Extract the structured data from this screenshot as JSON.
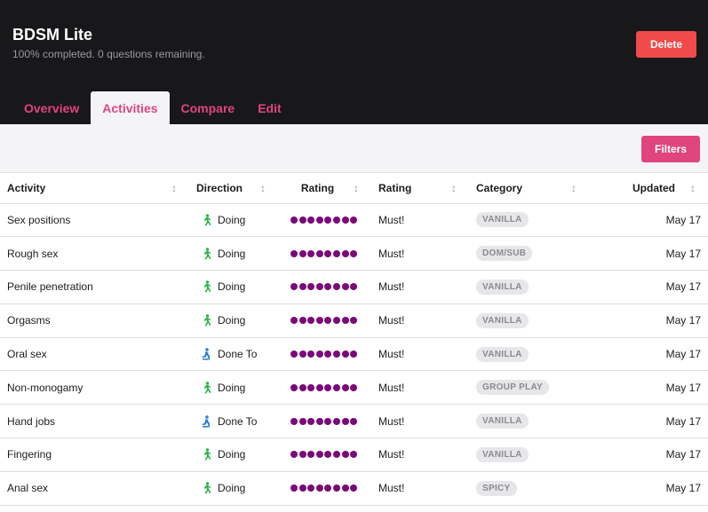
{
  "header": {
    "title": "BDSM Lite",
    "subtitle": "100% completed. 0 questions remaining.",
    "delete_label": "Delete",
    "bg_color": "#18181a",
    "delete_color": "#f04a4a"
  },
  "tabs": [
    {
      "label": "Overview",
      "active": false
    },
    {
      "label": "Activities",
      "active": true
    },
    {
      "label": "Compare",
      "active": false
    },
    {
      "label": "Edit",
      "active": false
    }
  ],
  "toolbar": {
    "filters_label": "Filters",
    "accent": "#e0457b"
  },
  "table": {
    "columns": [
      "Activity",
      "Direction",
      "Rating",
      "Rating",
      "Category",
      "Updated"
    ],
    "rating_color": "#7a0a78",
    "rows": [
      {
        "activity": "Sex positions",
        "direction": "Doing",
        "direction_icon": "running-person-icon",
        "dots": 8,
        "rating": "Must!",
        "category": "VANILLA",
        "updated": "May 17"
      },
      {
        "activity": "Rough sex",
        "direction": "Doing",
        "direction_icon": "running-person-icon",
        "dots": 8,
        "rating": "Must!",
        "category": "DOM/SUB",
        "updated": "May 17"
      },
      {
        "activity": "Penile penetration",
        "direction": "Doing",
        "direction_icon": "running-person-icon",
        "dots": 8,
        "rating": "Must!",
        "category": "VANILLA",
        "updated": "May 17"
      },
      {
        "activity": "Orgasms",
        "direction": "Doing",
        "direction_icon": "running-person-icon",
        "dots": 8,
        "rating": "Must!",
        "category": "VANILLA",
        "updated": "May 17"
      },
      {
        "activity": "Oral sex",
        "direction": "Done To",
        "direction_icon": "kneeling-person-icon",
        "dots": 8,
        "rating": "Must!",
        "category": "VANILLA",
        "updated": "May 17"
      },
      {
        "activity": "Non-monogamy",
        "direction": "Doing",
        "direction_icon": "running-person-icon",
        "dots": 8,
        "rating": "Must!",
        "category": "GROUP PLAY",
        "updated": "May 17"
      },
      {
        "activity": "Hand jobs",
        "direction": "Done To",
        "direction_icon": "kneeling-person-icon",
        "dots": 8,
        "rating": "Must!",
        "category": "VANILLA",
        "updated": "May 17"
      },
      {
        "activity": "Fingering",
        "direction": "Doing",
        "direction_icon": "running-person-icon",
        "dots": 8,
        "rating": "Must!",
        "category": "VANILLA",
        "updated": "May 17"
      },
      {
        "activity": "Anal sex",
        "direction": "Doing",
        "direction_icon": "running-person-icon",
        "dots": 8,
        "rating": "Must!",
        "category": "SPICY",
        "updated": "May 17"
      }
    ]
  }
}
